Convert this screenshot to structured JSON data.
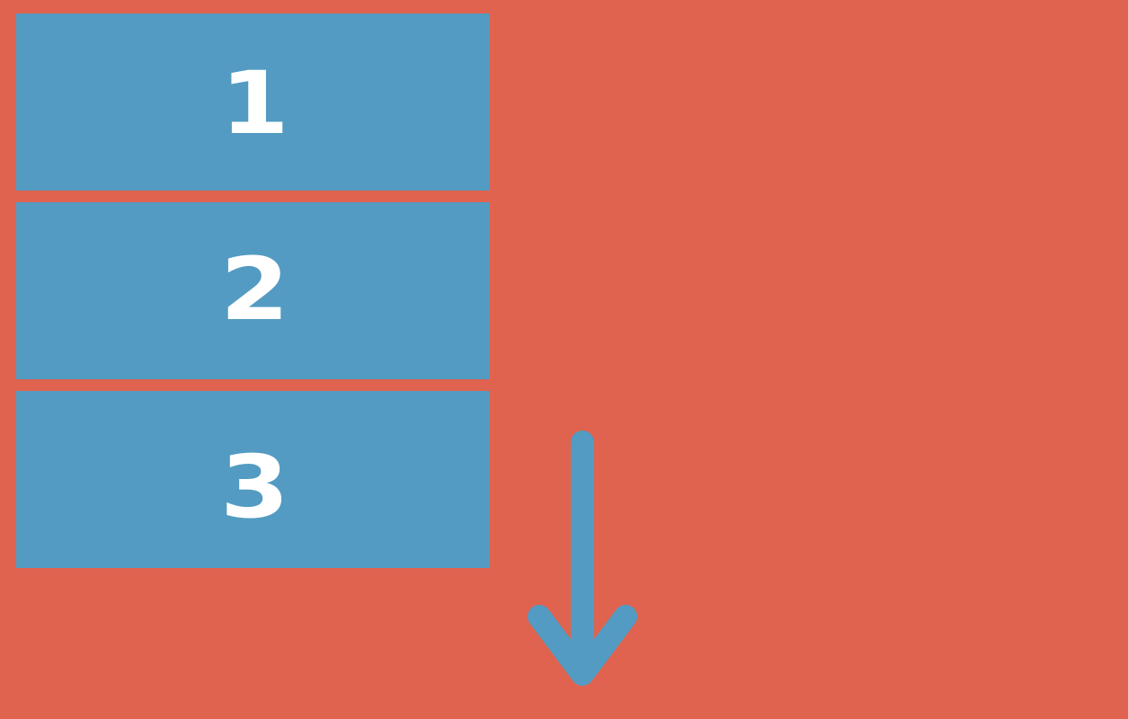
{
  "colors": {
    "background": "#df634e",
    "box_fill": "#539bc2",
    "label_text": "#ffffff",
    "arrow": "#539bc2"
  },
  "stack": {
    "items": [
      {
        "label": "1"
      },
      {
        "label": "2"
      },
      {
        "label": "3"
      }
    ]
  },
  "arrow": {
    "direction": "down",
    "icon": "arrow-down-icon"
  }
}
